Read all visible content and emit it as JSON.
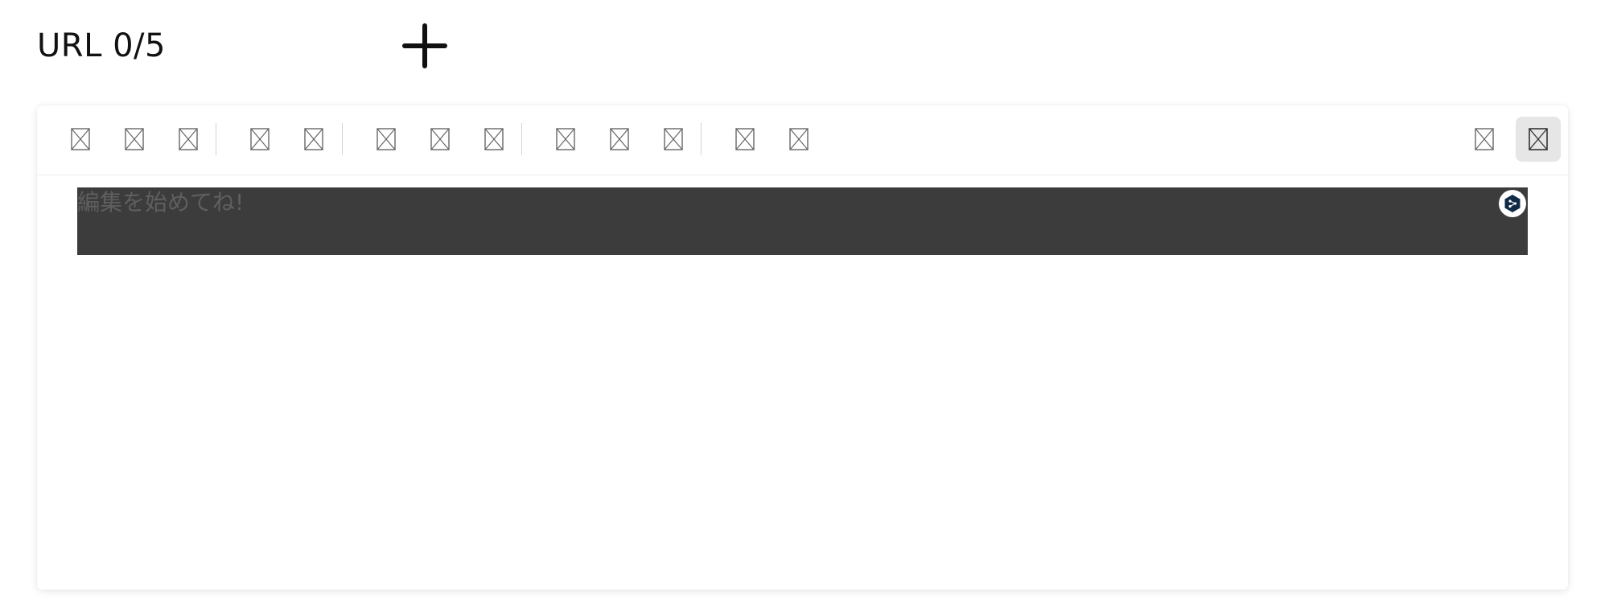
{
  "header": {
    "url_counter": "URL 0/5",
    "add_icon": "plus-icon"
  },
  "toolbar": {
    "buttons": [
      {
        "icon": "broken-image-icon"
      },
      {
        "icon": "broken-image-icon"
      },
      {
        "icon": "broken-image-icon"
      },
      {
        "icon": "broken-image-icon"
      },
      {
        "icon": "broken-image-icon"
      },
      {
        "icon": "broken-image-icon"
      },
      {
        "icon": "broken-image-icon"
      },
      {
        "icon": "broken-image-icon"
      },
      {
        "icon": "broken-image-icon"
      },
      {
        "icon": "broken-image-icon"
      },
      {
        "icon": "broken-image-icon"
      },
      {
        "icon": "broken-image-icon"
      },
      {
        "icon": "broken-image-icon"
      },
      {
        "icon": "broken-image-icon"
      },
      {
        "icon": "broken-image-icon",
        "active": true
      }
    ]
  },
  "editor": {
    "placeholder": "編集を始めてね!",
    "background_color": "#3c3c3c",
    "badge_icon": "deepl-logo-icon",
    "badge_color": "#0f2b46"
  }
}
